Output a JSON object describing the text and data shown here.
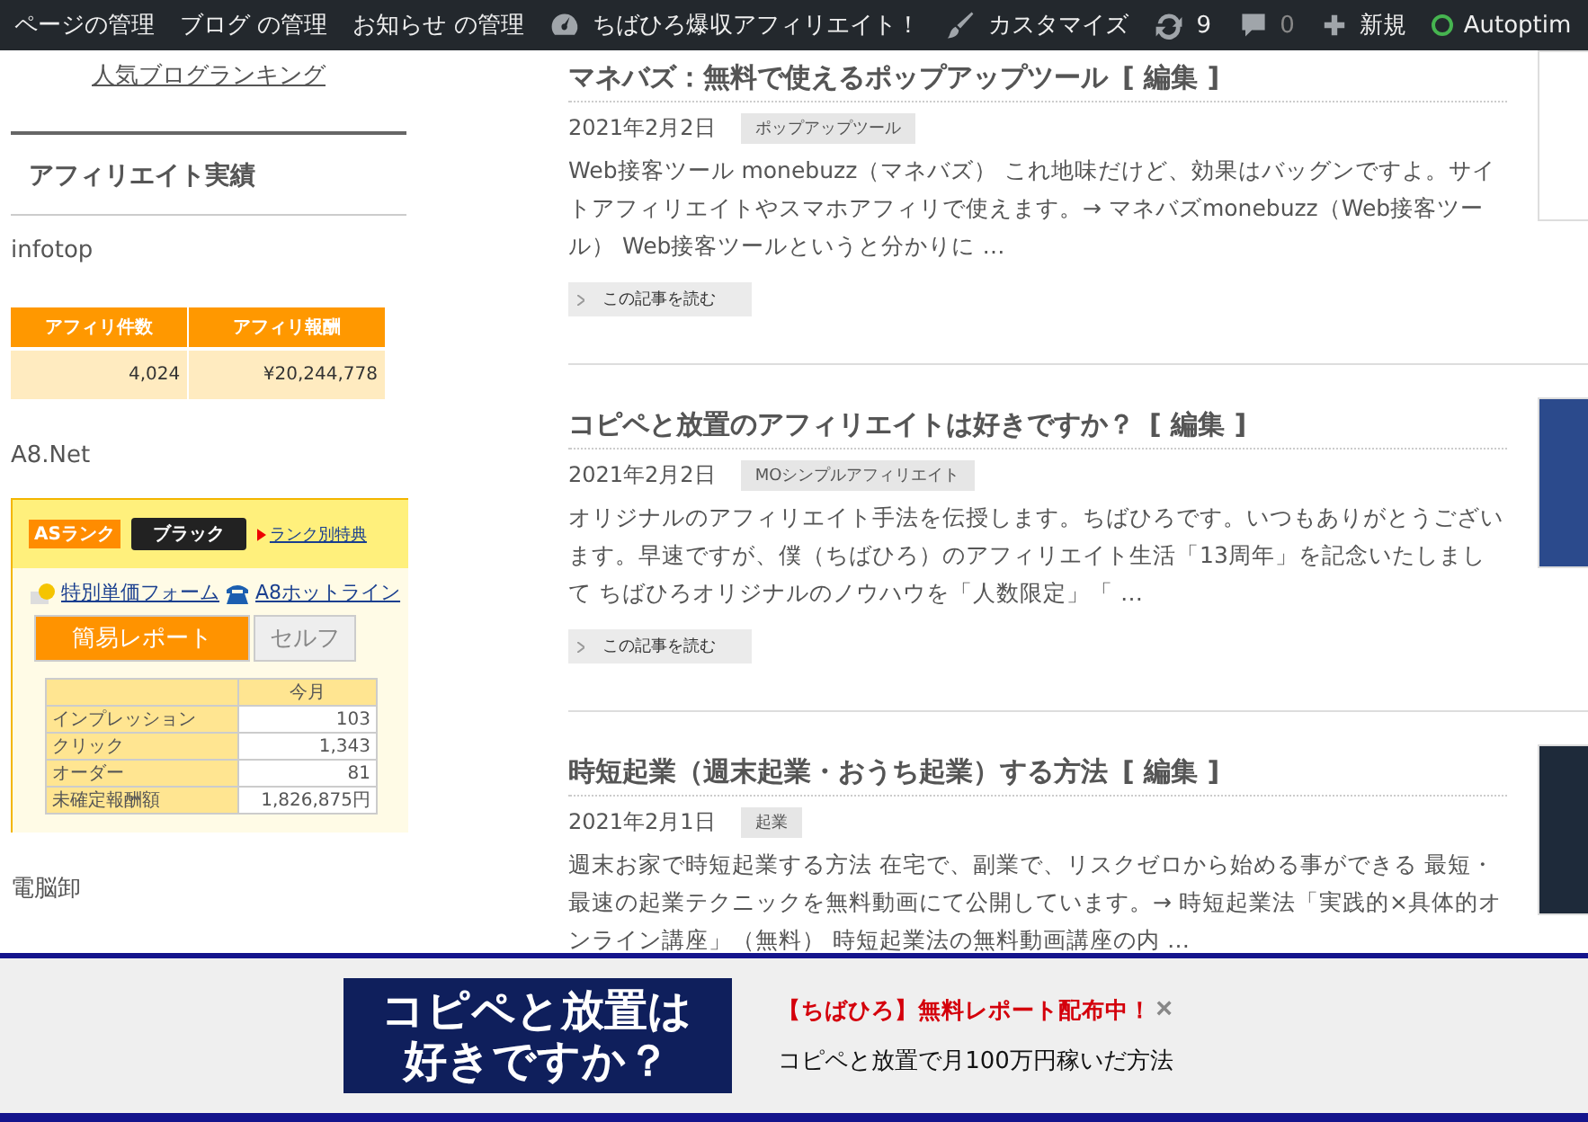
{
  "admin_bar": {
    "items": [
      {
        "kind": "text",
        "label": "ページの管理"
      },
      {
        "kind": "text",
        "label": "ブログ の管理"
      },
      {
        "kind": "text",
        "label": "お知らせ の管理"
      },
      {
        "kind": "gauge",
        "label": "ちばひろ爆収アフィリエイト！"
      },
      {
        "kind": "brush",
        "label": "カスタマイズ"
      },
      {
        "kind": "updates",
        "label": "9"
      },
      {
        "kind": "comments",
        "label": "0"
      },
      {
        "kind": "plus",
        "label": "新規"
      },
      {
        "kind": "status",
        "label": "Autoptim"
      }
    ]
  },
  "sidebar": {
    "ranking_link": "人気ブログランキング",
    "section_title": "アフィリエイト実績",
    "infotop_label": "infotop",
    "infotop_table": {
      "columns": [
        "アフィリ件数",
        "アフィリ報酬"
      ],
      "rows": [
        [
          "4,024",
          "¥20,244,778"
        ]
      ]
    },
    "a8_label": "A8.Net",
    "a8_widget": {
      "rank_label": "ASランク",
      "rank": "ブラック",
      "rank_link": "ランク別特典",
      "links": [
        {
          "kind": "coin",
          "label": "特別単価フォーム"
        },
        {
          "kind": "phone",
          "label": "A8ホットライン"
        }
      ],
      "tabs": [
        {
          "label": "簡易レポート",
          "selected": true
        },
        {
          "label": "セルフ",
          "selected": false
        }
      ],
      "column": "今月",
      "rows": [
        [
          "インプレッション",
          "103"
        ],
        [
          "クリック",
          "1,343"
        ],
        [
          "オーダー",
          "81"
        ],
        [
          "未確定報酬額",
          "1,826,875円"
        ]
      ]
    },
    "footer_label": "電脳卸"
  },
  "posts": [
    {
      "title": "マネバズ：無料で使えるポップアップツール",
      "edit_link": "[ 編集 ]",
      "date": "2021年2月2日",
      "category": "ポップアップツール",
      "excerpt": "Web接客ツール monebuzz（マネバズ） これ地味だけど、効果はバッグンですよ。サイトアフィリエイトやスマホアフィリで使えます。→ マネバズmonebuzz（Web接客ツール） Web接客ツールというと分かりに …",
      "read_more": "この記事を読む",
      "thumbnail": {
        "color": "#ffffff"
      }
    },
    {
      "title": "コピペと放置のアフィリエイトは好きですか？",
      "edit_link": "[ 編集 ]",
      "date": "2021年2月2日",
      "category": "MOシンプルアフィリエイト",
      "excerpt": "オリジナルのアフィリエイト手法を伝授します。ちばひろです。いつもありがとうございます。早速ですが、僕（ちばひろ）のアフィリエイト生活「13周年」を記念いたしまして ちばひろオリジナルのノウハウを「人数限定」「 …",
      "read_more": "この記事を読む",
      "thumbnail": {
        "color": "#2b4a8c"
      }
    },
    {
      "title": "時短起業（週末起業・おうち起業）する方法",
      "edit_link": "[ 編集 ]",
      "date": "2021年2月1日",
      "category": "起業",
      "excerpt": "週末お家で時短起業する方法 在宅で、副業で、リスクゼロから始める事ができる 最短・最速の起業テクニックを無料動画にて公開しています。→ 時短起業法「実践的×具体的オンライン講座」（無料） 時短起業法の無料動画講座の内 …",
      "thumbnail": {
        "color": "#1e2a3a"
      }
    }
  ],
  "banner": {
    "heading": [
      "コピペと放置は",
      "好きですか？"
    ],
    "headline": "【ちばひろ】無料レポート配布中！",
    "close": "×",
    "subtext": "コピペと放置で月100万円稼いだ方法"
  }
}
